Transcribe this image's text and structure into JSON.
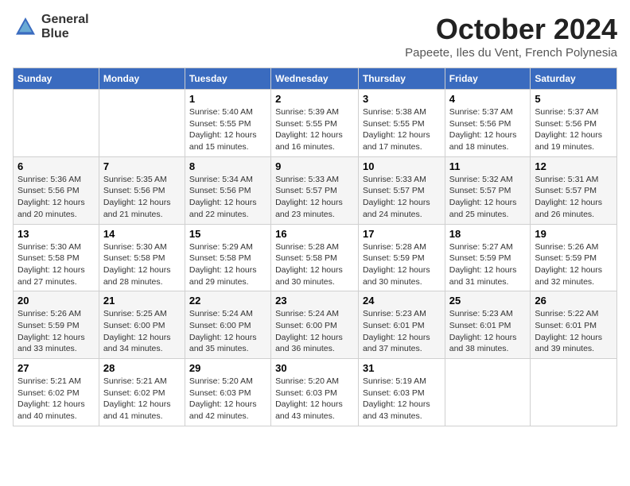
{
  "logo": {
    "text1": "General",
    "text2": "Blue"
  },
  "title": "October 2024",
  "location": "Papeete, Iles du Vent, French Polynesia",
  "headers": [
    "Sunday",
    "Monday",
    "Tuesday",
    "Wednesday",
    "Thursday",
    "Friday",
    "Saturday"
  ],
  "weeks": [
    [
      {
        "day": "",
        "info": ""
      },
      {
        "day": "",
        "info": ""
      },
      {
        "day": "1",
        "info": "Sunrise: 5:40 AM\nSunset: 5:55 PM\nDaylight: 12 hours and 15 minutes."
      },
      {
        "day": "2",
        "info": "Sunrise: 5:39 AM\nSunset: 5:55 PM\nDaylight: 12 hours and 16 minutes."
      },
      {
        "day": "3",
        "info": "Sunrise: 5:38 AM\nSunset: 5:55 PM\nDaylight: 12 hours and 17 minutes."
      },
      {
        "day": "4",
        "info": "Sunrise: 5:37 AM\nSunset: 5:56 PM\nDaylight: 12 hours and 18 minutes."
      },
      {
        "day": "5",
        "info": "Sunrise: 5:37 AM\nSunset: 5:56 PM\nDaylight: 12 hours and 19 minutes."
      }
    ],
    [
      {
        "day": "6",
        "info": "Sunrise: 5:36 AM\nSunset: 5:56 PM\nDaylight: 12 hours and 20 minutes."
      },
      {
        "day": "7",
        "info": "Sunrise: 5:35 AM\nSunset: 5:56 PM\nDaylight: 12 hours and 21 minutes."
      },
      {
        "day": "8",
        "info": "Sunrise: 5:34 AM\nSunset: 5:56 PM\nDaylight: 12 hours and 22 minutes."
      },
      {
        "day": "9",
        "info": "Sunrise: 5:33 AM\nSunset: 5:57 PM\nDaylight: 12 hours and 23 minutes."
      },
      {
        "day": "10",
        "info": "Sunrise: 5:33 AM\nSunset: 5:57 PM\nDaylight: 12 hours and 24 minutes."
      },
      {
        "day": "11",
        "info": "Sunrise: 5:32 AM\nSunset: 5:57 PM\nDaylight: 12 hours and 25 minutes."
      },
      {
        "day": "12",
        "info": "Sunrise: 5:31 AM\nSunset: 5:57 PM\nDaylight: 12 hours and 26 minutes."
      }
    ],
    [
      {
        "day": "13",
        "info": "Sunrise: 5:30 AM\nSunset: 5:58 PM\nDaylight: 12 hours and 27 minutes."
      },
      {
        "day": "14",
        "info": "Sunrise: 5:30 AM\nSunset: 5:58 PM\nDaylight: 12 hours and 28 minutes."
      },
      {
        "day": "15",
        "info": "Sunrise: 5:29 AM\nSunset: 5:58 PM\nDaylight: 12 hours and 29 minutes."
      },
      {
        "day": "16",
        "info": "Sunrise: 5:28 AM\nSunset: 5:58 PM\nDaylight: 12 hours and 30 minutes."
      },
      {
        "day": "17",
        "info": "Sunrise: 5:28 AM\nSunset: 5:59 PM\nDaylight: 12 hours and 30 minutes."
      },
      {
        "day": "18",
        "info": "Sunrise: 5:27 AM\nSunset: 5:59 PM\nDaylight: 12 hours and 31 minutes."
      },
      {
        "day": "19",
        "info": "Sunrise: 5:26 AM\nSunset: 5:59 PM\nDaylight: 12 hours and 32 minutes."
      }
    ],
    [
      {
        "day": "20",
        "info": "Sunrise: 5:26 AM\nSunset: 5:59 PM\nDaylight: 12 hours and 33 minutes."
      },
      {
        "day": "21",
        "info": "Sunrise: 5:25 AM\nSunset: 6:00 PM\nDaylight: 12 hours and 34 minutes."
      },
      {
        "day": "22",
        "info": "Sunrise: 5:24 AM\nSunset: 6:00 PM\nDaylight: 12 hours and 35 minutes."
      },
      {
        "day": "23",
        "info": "Sunrise: 5:24 AM\nSunset: 6:00 PM\nDaylight: 12 hours and 36 minutes."
      },
      {
        "day": "24",
        "info": "Sunrise: 5:23 AM\nSunset: 6:01 PM\nDaylight: 12 hours and 37 minutes."
      },
      {
        "day": "25",
        "info": "Sunrise: 5:23 AM\nSunset: 6:01 PM\nDaylight: 12 hours and 38 minutes."
      },
      {
        "day": "26",
        "info": "Sunrise: 5:22 AM\nSunset: 6:01 PM\nDaylight: 12 hours and 39 minutes."
      }
    ],
    [
      {
        "day": "27",
        "info": "Sunrise: 5:21 AM\nSunset: 6:02 PM\nDaylight: 12 hours and 40 minutes."
      },
      {
        "day": "28",
        "info": "Sunrise: 5:21 AM\nSunset: 6:02 PM\nDaylight: 12 hours and 41 minutes."
      },
      {
        "day": "29",
        "info": "Sunrise: 5:20 AM\nSunset: 6:03 PM\nDaylight: 12 hours and 42 minutes."
      },
      {
        "day": "30",
        "info": "Sunrise: 5:20 AM\nSunset: 6:03 PM\nDaylight: 12 hours and 43 minutes."
      },
      {
        "day": "31",
        "info": "Sunrise: 5:19 AM\nSunset: 6:03 PM\nDaylight: 12 hours and 43 minutes."
      },
      {
        "day": "",
        "info": ""
      },
      {
        "day": "",
        "info": ""
      }
    ]
  ]
}
